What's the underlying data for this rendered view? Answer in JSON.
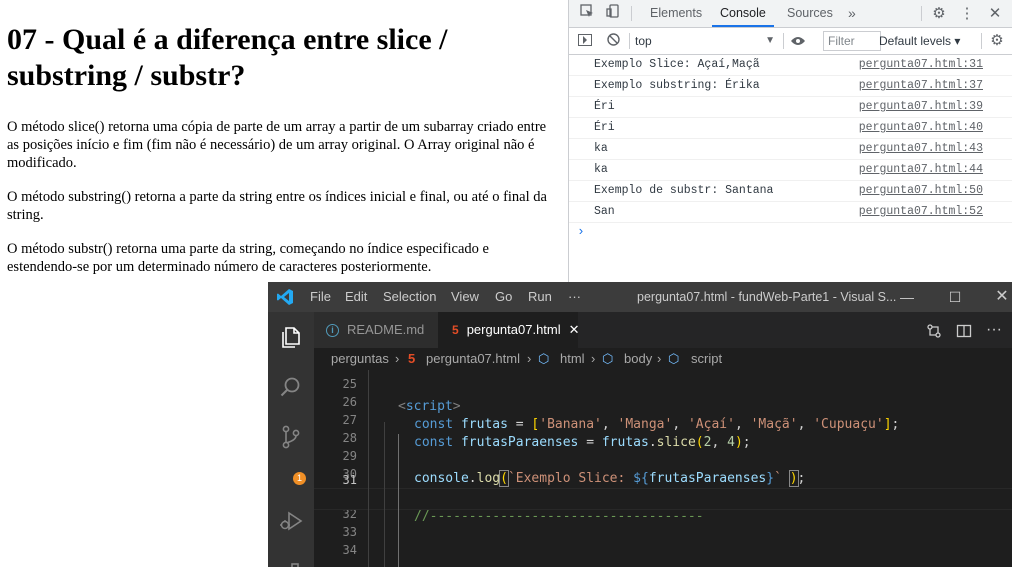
{
  "page": {
    "heading": "07 - Qual é a diferença entre slice / substring / substr?",
    "paragraphs": [
      "O método slice() retorna uma cópia de parte de um array a partir de um subarray criado entre as posições início e fim (fim não é necessário) de um array original. O Array original não é modificado.",
      "O método substring() retorna a parte da string entre os índices inicial e final, ou até o final da string.",
      "O método substr() retorna uma parte da string, começando no índice especificado e estendendo-se por um determinado número de caracteres posteriormente."
    ]
  },
  "devtools": {
    "tabs": [
      "Elements",
      "Console",
      "Sources"
    ],
    "active_tab": "Console",
    "more_tabs_glyph": "»",
    "context": "top",
    "filter_placeholder": "Filter",
    "levels_label": "Default levels ▾",
    "console": [
      {
        "message": "Exemplo Slice: Açaí,Maçã",
        "source": "pergunta07.html:31"
      },
      {
        "message": "Exemplo substring: Érika",
        "source": "pergunta07.html:37"
      },
      {
        "message": "Éri",
        "source": "pergunta07.html:39"
      },
      {
        "message": "Éri",
        "source": "pergunta07.html:40"
      },
      {
        "message": "ka",
        "source": "pergunta07.html:43"
      },
      {
        "message": "ka",
        "source": "pergunta07.html:44"
      },
      {
        "message": "Exemplo de substr: Santana",
        "source": "pergunta07.html:50"
      },
      {
        "message": "San",
        "source": "pergunta07.html:52"
      }
    ],
    "prompt_glyph": "›"
  },
  "vscode": {
    "menu": [
      "File",
      "Edit",
      "Selection",
      "View",
      "Go",
      "Run",
      "···"
    ],
    "window_title": "pergunta07.html - fundWeb-Parte1 - Visual S...",
    "scm_badge": "1",
    "tabs": [
      {
        "label": "README.md",
        "active": false
      },
      {
        "label": "pergunta07.html",
        "active": true
      }
    ],
    "breadcrumb": [
      "perguntas",
      "pergunta07.html",
      "html",
      "body",
      "script"
    ],
    "line_numbers": [
      "25",
      "26",
      "27",
      "28",
      "29",
      "30",
      "31",
      "32",
      "33",
      "34"
    ],
    "current_line": "31",
    "code": {
      "l27_tag": "script",
      "l28_kw": "const",
      "l28_var": "frutas",
      "l28_items": [
        "'Banana'",
        "'Manga'",
        "'Açaí'",
        "'Maçã'",
        "'Cupuaçu'"
      ],
      "l29_kw": "const",
      "l29_var": "frutasParaenses",
      "l29_obj": "frutas",
      "l29_fn": "slice",
      "l29_args": [
        "2",
        "4"
      ],
      "l31_obj": "console",
      "l31_fn": "log",
      "l31_str": "`Exemplo Slice: ",
      "l31_interp_var": "frutasParaenses",
      "l33_comment": "//-----------------------------------"
    }
  },
  "colors": {
    "vscode_bg": "#1e1e1e",
    "vscode_titlebar": "#3c3c3c",
    "devtools_accent": "#1a73e8",
    "badge": "#f08f26"
  }
}
